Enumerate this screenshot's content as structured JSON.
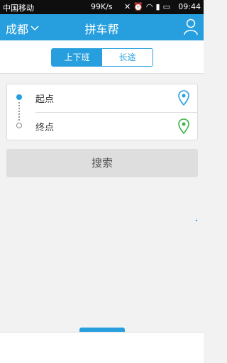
{
  "status_bar": {
    "carrier": "中国移动",
    "net_speed": "99K/s",
    "time": "09:44"
  },
  "header": {
    "city": "成都",
    "title": "拼车帮"
  },
  "tabs": [
    {
      "label": "上下班",
      "active": true
    },
    {
      "label": "长途",
      "active": false
    }
  ],
  "route": {
    "start_label": "起点",
    "end_label": "终点"
  },
  "search_button": "搜索",
  "colors": {
    "accent": "#279fde",
    "start_pin": "#279fde",
    "end_pin": "#3bb44a"
  }
}
